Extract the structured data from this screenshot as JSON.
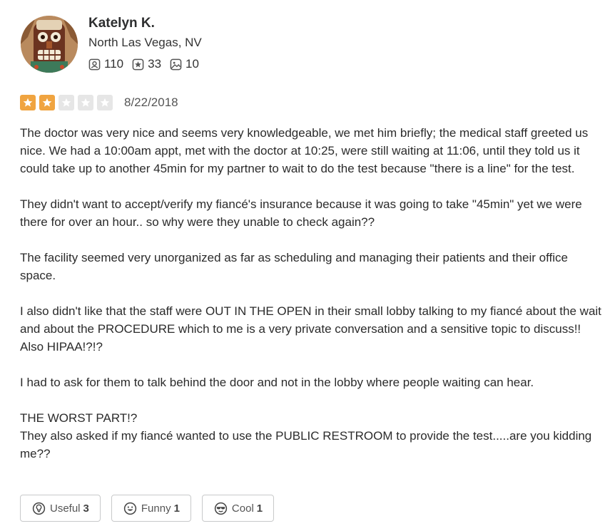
{
  "user": {
    "name": "Katelyn K.",
    "location": "North Las Vegas, NV",
    "avatar_icon": "tiki-mask-avatar",
    "stats": {
      "friends": "110",
      "reviews": "33",
      "photos": "10"
    }
  },
  "review": {
    "rating": 2,
    "rating_max": 5,
    "star_color": "#f0a440",
    "date": "8/22/2018",
    "paragraphs": [
      "The doctor was very nice and seems very knowledgeable, we met him briefly; the medical staff greeted us nice. We had a 10:00am appt, met with the doctor at 10:25, were still waiting at 11:06, until they told us it could take up to another 45min for my partner to wait to do the test because \"there is a line\" for the test.",
      "They didn't want to accept/verify  my fiancé's insurance because it was going to take \"45min\" yet we were there for over an hour.. so why were they unable to check again??",
      "The facility seemed very unorganized as far as scheduling and managing their patients and their office space.",
      "I also didn't like that the staff were OUT IN THE OPEN in their small lobby talking to my fiancé about the wait and about the PROCEDURE  which to me is a very private conversation and a sensitive topic to discuss!! Also HIPAA!?!?",
      "I had to ask for them to  talk behind  the door and not in the lobby where people waiting can hear.",
      "THE WORST PART!?\nThey also asked if my fiancé wanted to use the PUBLIC RESTROOM to provide the test.....are you kidding me??"
    ]
  },
  "reactions": {
    "useful": {
      "label": "Useful",
      "count": "3",
      "icon": "lightbulb-icon"
    },
    "funny": {
      "label": "Funny",
      "count": "1",
      "icon": "smile-icon"
    },
    "cool": {
      "label": "Cool",
      "count": "1",
      "icon": "sunglasses-icon"
    }
  }
}
